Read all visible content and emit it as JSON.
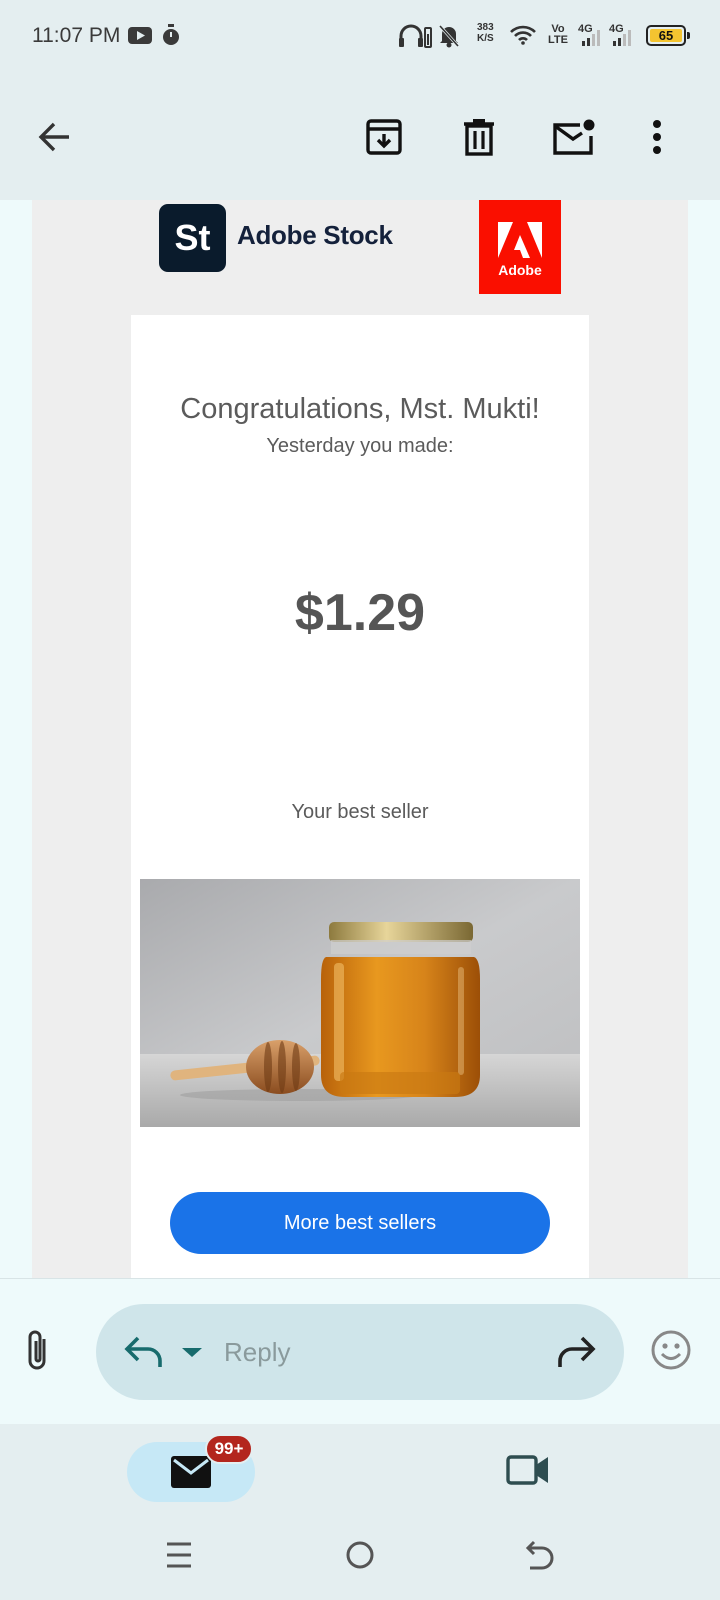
{
  "status_bar": {
    "time": "11:07 PM",
    "net_speed_value": "383",
    "net_speed_unit": "K/S",
    "volte_top": "Vo",
    "volte_bottom": "LTE",
    "sim1_type": "4G",
    "sim2_type": "4G",
    "battery": "65"
  },
  "app_bar": {
    "icons": [
      "back-arrow-icon",
      "archive-icon",
      "delete-icon",
      "mark-unread-icon",
      "more-vert-icon"
    ]
  },
  "email": {
    "brand_logo": "St",
    "brand_name": "Adobe Stock",
    "partner_logo": "Adobe",
    "greeting": "Congratulations, Mst. Mukti!",
    "subtitle": "Yesterday you made:",
    "amount": "$1.29",
    "best_seller_label": "Your best seller",
    "cta_label": "More best sellers",
    "colors": {
      "cta": "#1a73e8",
      "adobe_red": "#fa0f00",
      "stock_navy": "#0a1b2c"
    }
  },
  "reply_bar": {
    "placeholder": "Reply"
  },
  "bottom_nav": {
    "mail_badge": "99+",
    "tabs": [
      "mail-tab",
      "meet-tab"
    ]
  },
  "system_nav": [
    "menu",
    "home",
    "back"
  ]
}
